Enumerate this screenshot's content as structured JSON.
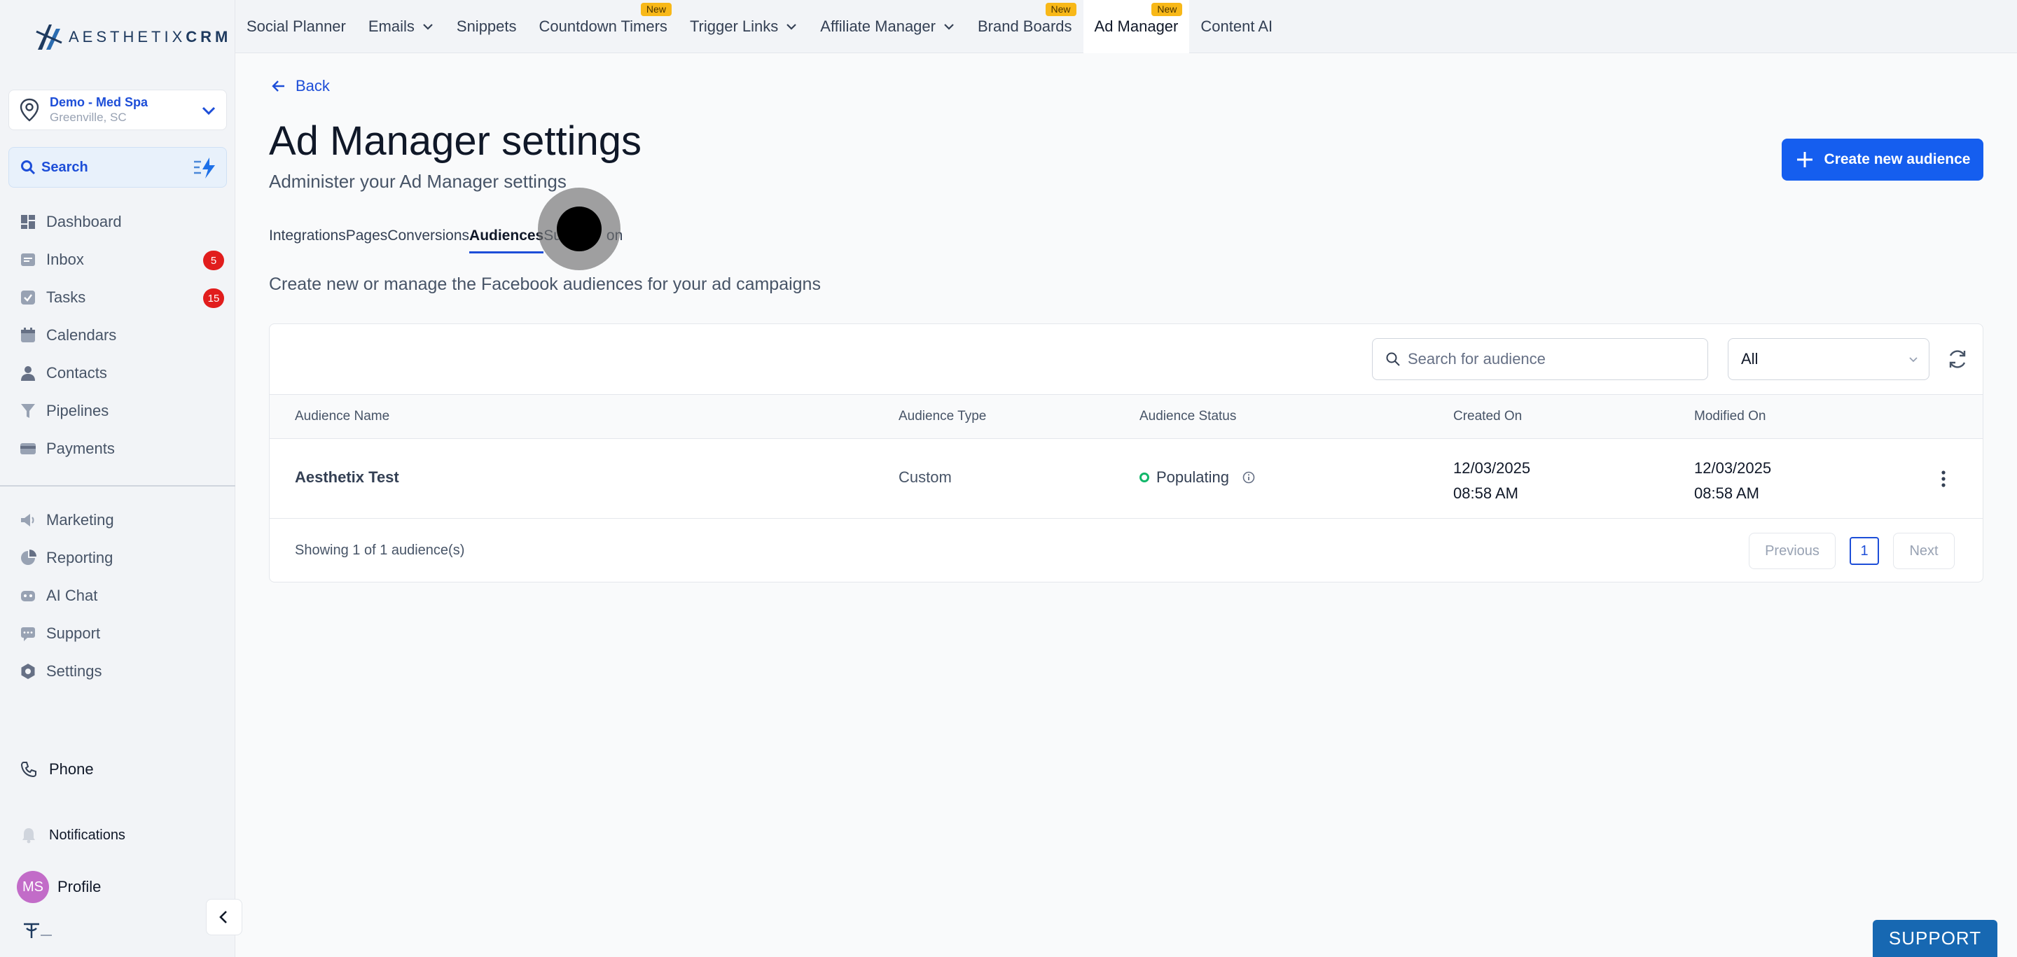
{
  "brand": {
    "name_light": "AESTHETIX",
    "name_bold": "CRM"
  },
  "location": {
    "name": "Demo - Med Spa",
    "city": "Greenville, SC"
  },
  "search": {
    "label": "Search"
  },
  "nav": [
    {
      "label": "Dashboard",
      "icon": "dashboard-icon"
    },
    {
      "label": "Inbox",
      "icon": "inbox-icon",
      "badge": "5"
    },
    {
      "label": "Tasks",
      "icon": "tasks-icon",
      "badge": "15"
    },
    {
      "label": "Calendars",
      "icon": "calendar-icon"
    },
    {
      "label": "Contacts",
      "icon": "contacts-icon"
    },
    {
      "label": "Pipelines",
      "icon": "pipelines-icon"
    },
    {
      "label": "Payments",
      "icon": "payments-icon"
    }
  ],
  "nav2": [
    {
      "label": "Marketing",
      "icon": "marketing-icon"
    },
    {
      "label": "Reporting",
      "icon": "reporting-icon"
    },
    {
      "label": "AI Chat",
      "icon": "ai-chat-icon"
    },
    {
      "label": "Support",
      "icon": "support-icon"
    },
    {
      "label": "Settings",
      "icon": "settings-icon"
    }
  ],
  "bottom": {
    "phone": "Phone",
    "notifications": "Notifications",
    "profile": "Profile",
    "avatar_initials": "MS"
  },
  "topnav": [
    {
      "label": "Social Planner"
    },
    {
      "label": "Emails",
      "caret": true
    },
    {
      "label": "Snippets"
    },
    {
      "label": "Countdown Timers",
      "badge": "New"
    },
    {
      "label": "Trigger Links",
      "caret": true
    },
    {
      "label": "Affiliate Manager",
      "caret": true
    },
    {
      "label": "Brand Boards",
      "badge": "New"
    },
    {
      "label": "Ad Manager",
      "badge": "New",
      "active": true
    },
    {
      "label": "Content AI"
    }
  ],
  "page": {
    "back": "Back",
    "title": "Ad Manager settings",
    "subtitle": "Administer your Ad Manager settings",
    "create_button": "Create new audience",
    "subtabs": [
      "Integrations",
      "Pages",
      "Conversions",
      "Audiences",
      "Subscription"
    ],
    "subtab_visible": [
      "Integrations",
      "Pages",
      "Conversions",
      "Audiences",
      "Su",
      "on"
    ],
    "active_subtab": "Audiences",
    "description": "Create new or manage the Facebook audiences for your ad campaigns"
  },
  "table": {
    "search_placeholder": "Search for audience",
    "filter_value": "All",
    "headers": [
      "Audience Name",
      "Audience Type",
      "Audience Status",
      "Created On",
      "Modified On"
    ],
    "rows": [
      {
        "name": "Aesthetix Test",
        "type": "Custom",
        "status": "Populating",
        "created_date": "12/03/2025",
        "created_time": "08:58 AM",
        "modified_date": "12/03/2025",
        "modified_time": "08:58 AM"
      }
    ],
    "showing": "Showing 1 of 1 audience(s)",
    "prev": "Previous",
    "page": "1",
    "next": "Next"
  },
  "support_button": "SUPPORT",
  "colors": {
    "accent": "#155eef",
    "badge": "#e11d1d",
    "new_badge": "#f8b818",
    "status_ok": "#12b76a"
  }
}
